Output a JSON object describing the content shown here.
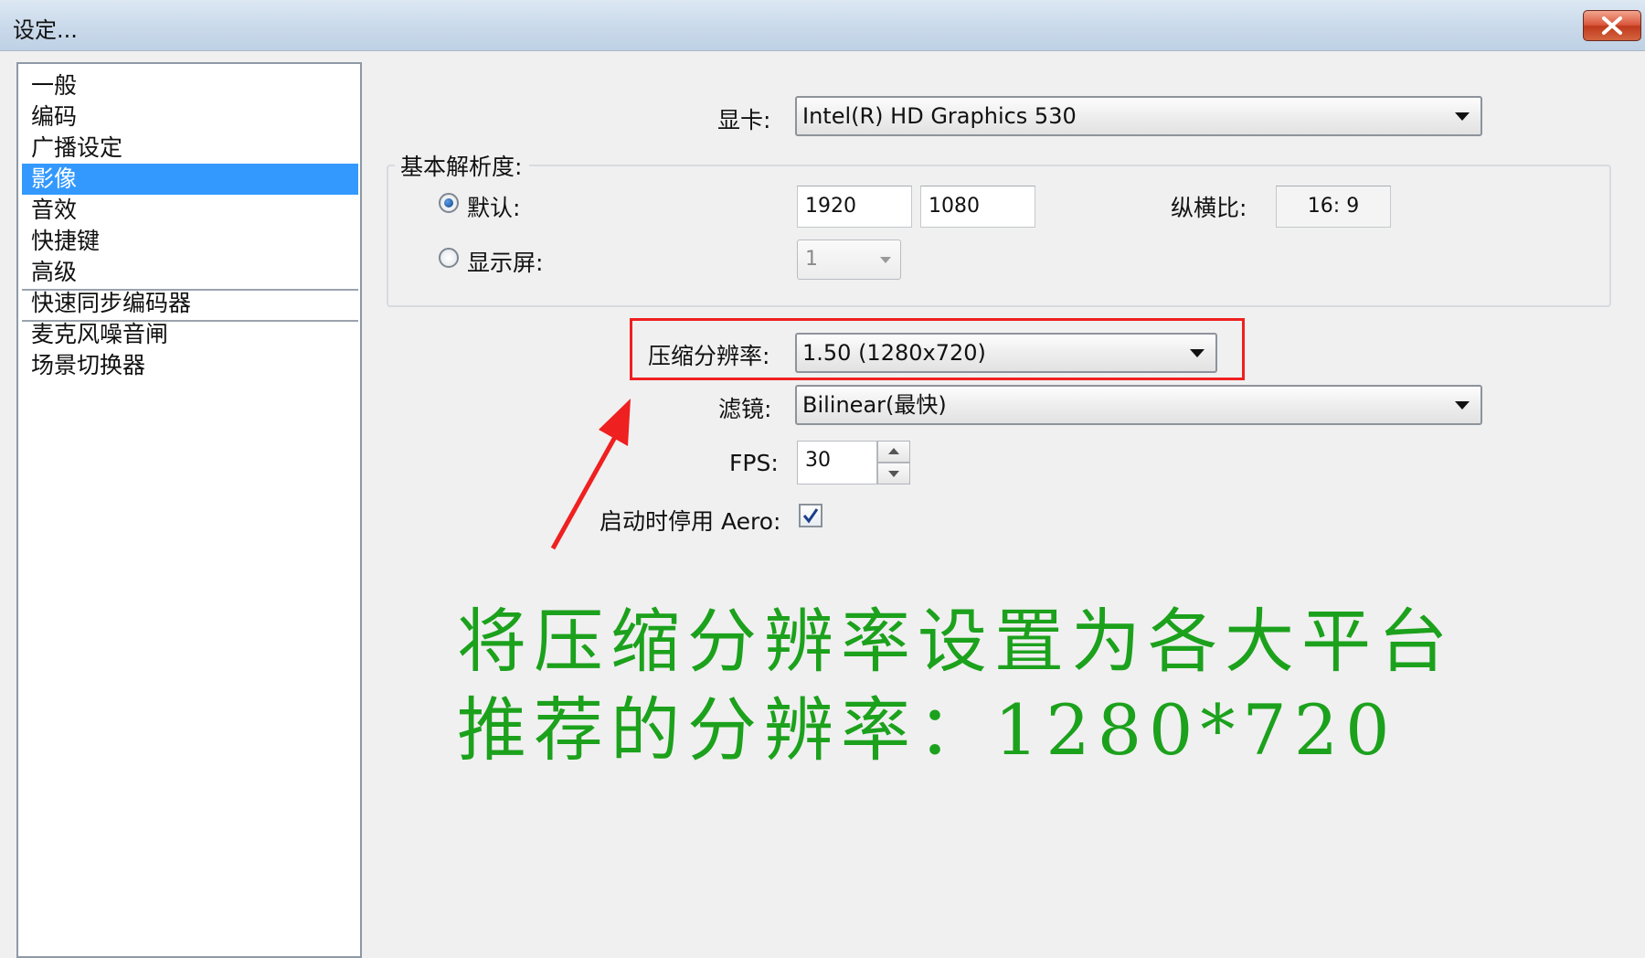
{
  "window": {
    "title": "设定..."
  },
  "sidebar": {
    "items": [
      {
        "label": "一般"
      },
      {
        "label": "编码"
      },
      {
        "label": "广播设定"
      },
      {
        "label": "影像",
        "selected": true
      },
      {
        "label": "音效"
      },
      {
        "label": "快捷键"
      },
      {
        "label": "高级"
      },
      {
        "label": "快速同步编码器"
      },
      {
        "label": "麦克风噪音闸"
      },
      {
        "label": "场景切换器"
      }
    ]
  },
  "video": {
    "gpu_label": "显卡:",
    "gpu_value": "Intel(R) HD Graphics 530",
    "base_resolution": {
      "group_label": "基本解析度:",
      "default_label": "默认:",
      "default_selected": true,
      "width": "1920",
      "height": "1080",
      "aspect_label": "纵横比:",
      "aspect_value": "16: 9",
      "monitor_label": "显示屏:",
      "monitor_value": "1"
    },
    "downscale_label": "压缩分辨率:",
    "downscale_value": "1.50  (1280x720)",
    "filter_label": "滤镜:",
    "filter_value": "Bilinear(最快)",
    "fps_label": "FPS:",
    "fps_value": "30",
    "aero_label": "启动时停用 Aero:",
    "aero_checked": true
  },
  "annotation": {
    "line1": "将压缩分辨率设置为各大平台",
    "line2": "推荐的分辨率：1280*720",
    "color": "#1ca11c"
  },
  "colors": {
    "selection": "#3399ff",
    "highlight_box": "#ef2020",
    "arrow": "#ef2020"
  }
}
